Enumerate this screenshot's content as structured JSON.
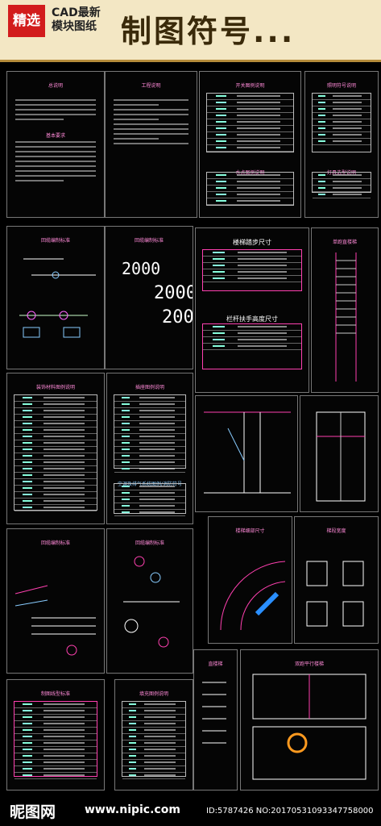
{
  "header": {
    "badge": "精选",
    "cad_line1": "CAD最新",
    "cad_line2": "模块图纸",
    "title": "制图符号..."
  },
  "panels": {
    "p1_title": "总说明",
    "p1_sub": "基本要求",
    "p2_title": "工程说明",
    "p3_title": "开关图例说明",
    "p3_sub": "水点图例说明",
    "p4_title": "照明符号说明",
    "p4_sub": "灯具选型说明",
    "p5_title": "回缆编制标准",
    "p6_title": "回缆编制标准",
    "p6_big": "2000",
    "p7_title": "楼梯踏步尺寸",
    "p7_sub": "栏杆扶手高度尺寸",
    "p8_title": "单跑直楼梯",
    "p9_title": "装饰材料图例说明",
    "p10_title": "插座图例说明",
    "p10_sub": "空调及排气系统图例/消防符号",
    "p11_title": "回缆编制标准",
    "p12_title": "回缆编制标准",
    "p13_title": "楼梯细部尺寸",
    "p13_side": "梯段宽度",
    "p14_title": "制图线型标准",
    "p15_title": "填充图例说明",
    "p16_title": "直楼梯",
    "p17_title": "双跑平行楼梯"
  },
  "footer": {
    "logo": "昵图网",
    "site": "www.nipic.com",
    "id": "ID:5787426 NO:20170531093347758000"
  }
}
